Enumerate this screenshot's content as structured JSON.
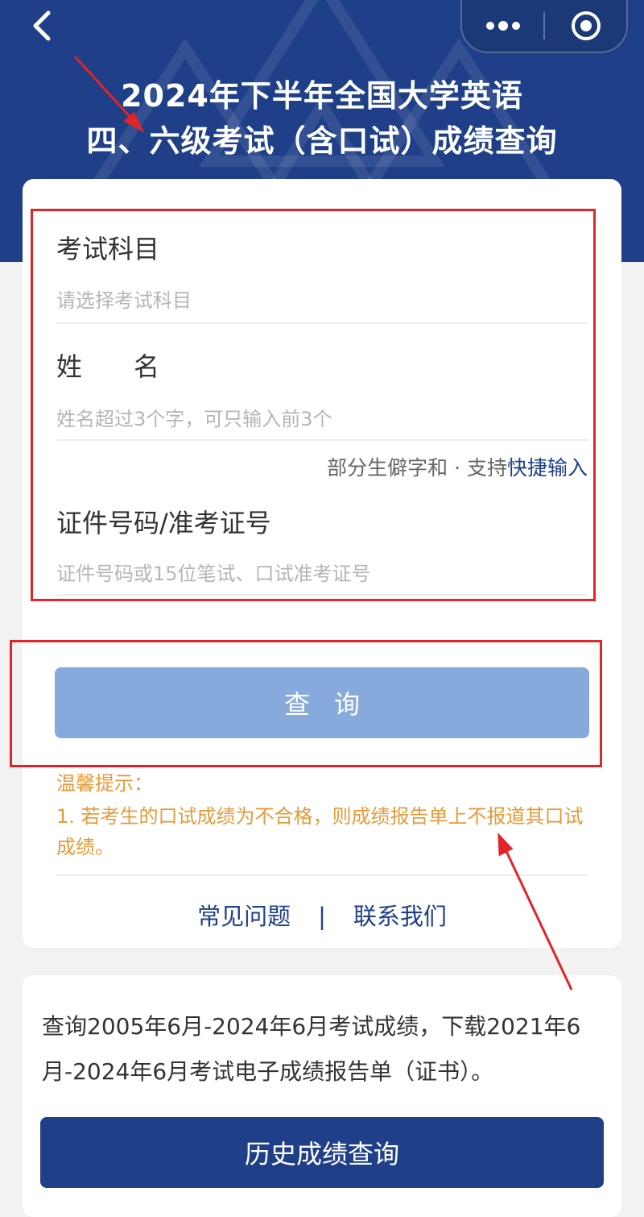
{
  "header": {
    "title_line1": "2024年下半年全国大学英语",
    "title_line2": "四、六级考试（含口试）成绩查询",
    "back_icon": "chevron-left-icon",
    "more_icon": "more-dots-icon",
    "close_icon": "target-circle-icon"
  },
  "form": {
    "subject": {
      "label": "考试科目",
      "placeholder": "请选择考试科目"
    },
    "name": {
      "label": "姓　　名",
      "placeholder": "姓名超过3个字，可只输入前3个"
    },
    "hint": {
      "text": "部分生僻字和 · 支持",
      "link": "快捷输入"
    },
    "id": {
      "label": "证件号码/准考证号",
      "placeholder": "证件号码或15位笔试、口试准考证号"
    },
    "query_button": "查询"
  },
  "tips": {
    "title": "温馨提示：",
    "body": "1. 若考生的口试成绩为不合格，则成绩报告单上不报道其口试成绩。"
  },
  "links": {
    "faq": "常见问题",
    "separator": "|",
    "contact": "联系我们"
  },
  "history": {
    "description": "查询2005年6月-2024年6月考试成绩，下载2021年6月-2024年6月考试电子成绩报告单（证书）。",
    "button": "历史成绩查询"
  },
  "colors": {
    "brand": "#1f4088",
    "query_button": "#86aadb",
    "tip": "#e49a38",
    "annotation": "#e0242a"
  }
}
